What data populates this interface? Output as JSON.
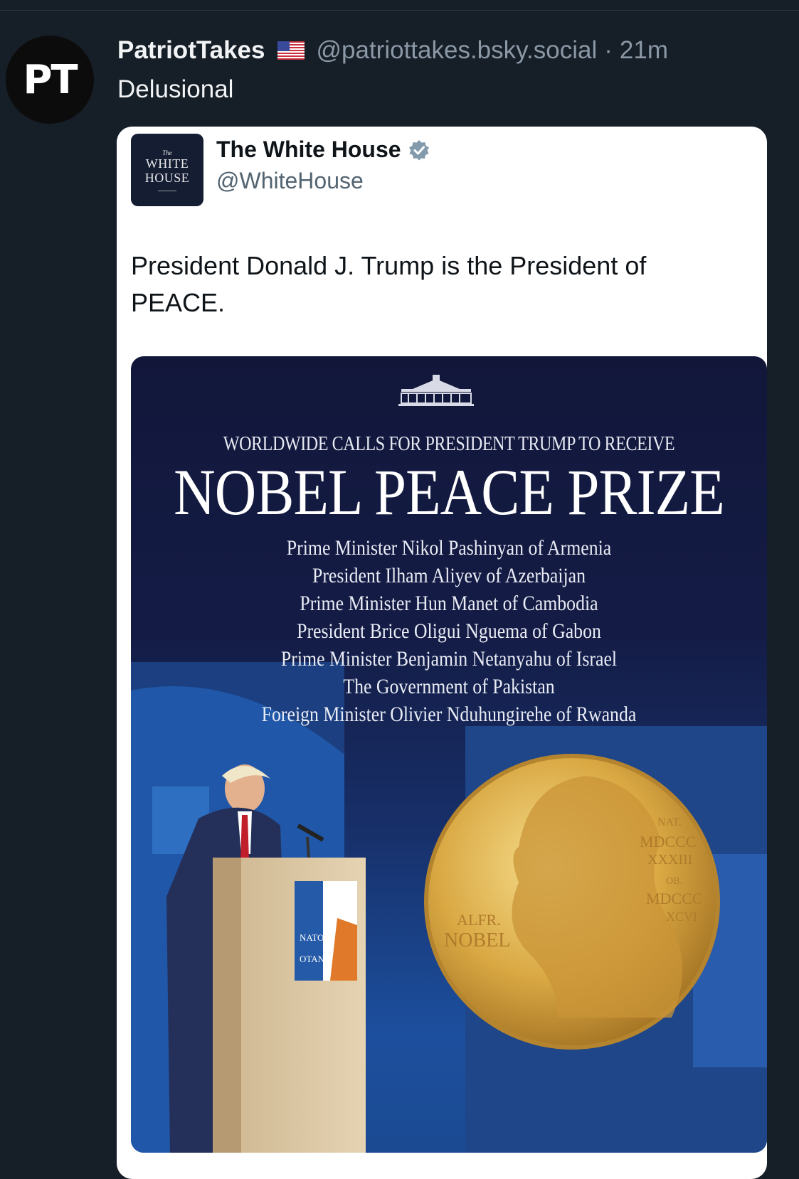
{
  "post": {
    "author_name": "PatriotTakes",
    "author_avatar_text": "PT",
    "flag_icon": "us-flag-icon",
    "handle": "@patriottakes.bsky.social",
    "separator": "·",
    "time": "21m",
    "text": "Delusional"
  },
  "quoted": {
    "logo": {
      "the": "The",
      "line1": "WHITE",
      "line2": "HOUSE"
    },
    "name": "The White House",
    "verified_icon": "verified-badge-icon",
    "handle": "@WhiteHouse",
    "text": "President Donald J. Trump is the President of PEACE."
  },
  "poster": {
    "subtitle": "WORLDWIDE CALLS FOR PRESIDENT TRUMP TO RECEIVE",
    "title": "NOBEL PEACE PRIZE",
    "names": [
      "Prime Minister Nikol Pashinyan of Armenia",
      "President Ilham Aliyev of Azerbaijan",
      "Prime Minister Hun Manet of Cambodia",
      "President Brice Oligui Nguema of Gabon",
      "Prime Minister Benjamin Netanyahu of Israel",
      "The Government of Pakistan",
      "Foreign Minister Olivier Nduhungirehe of Rwanda"
    ],
    "podium_text": [
      "NATO",
      "OTAN"
    ],
    "medal_text": [
      "ALFR.",
      "NOBEL",
      "NAT.",
      "MDCCC",
      "XXXIII",
      "OB.",
      "MDCCC",
      "XCVI"
    ]
  },
  "colors": {
    "background": "#161e27",
    "card": "#ffffff",
    "poster_navy": "#141c46",
    "gold": "#d9a843"
  }
}
